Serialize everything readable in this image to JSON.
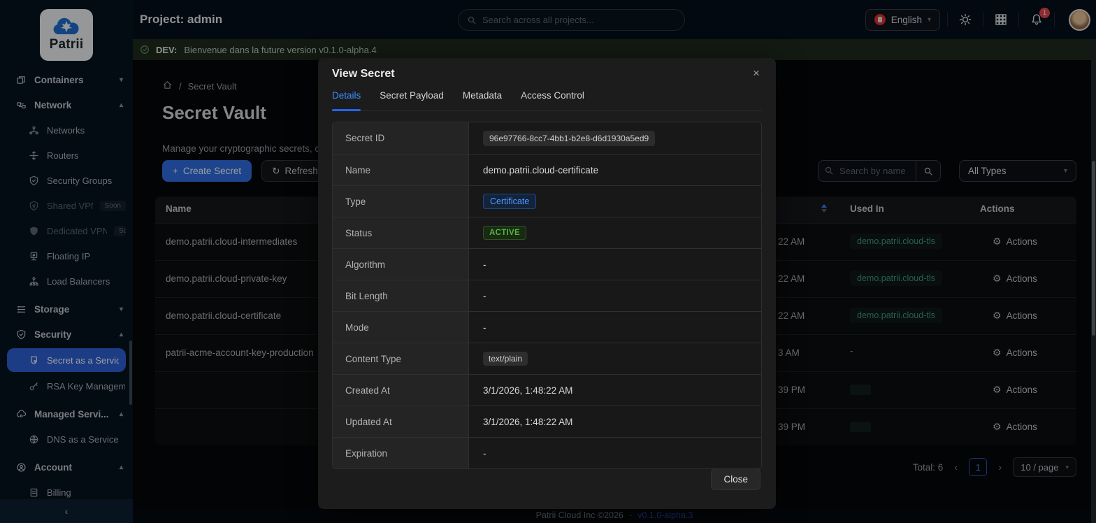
{
  "colors": {
    "accent": "#2f6fe4",
    "status_green": "#58b33c",
    "link_teal": "#3f9b83",
    "banner_bg": "#1d2b1d",
    "sidebar_active_bg": "#2f62d8"
  },
  "topbar": {
    "project_label": "Project: admin",
    "search_placeholder": "Search across all projects...",
    "language": "English",
    "bell_badge": "1"
  },
  "sidebar": {
    "logo_text": "Patrii",
    "items": {
      "containers": "Containers",
      "network": "Network",
      "networks": "Networks",
      "routers": "Routers",
      "security_groups": "Security Groups",
      "shared_vpn": "Shared VPN",
      "shared_vpn_badge": "Soon",
      "dedicated_vpn": "Dedicated VPN",
      "dedicated_vpn_badge": "Soon",
      "floating_ip": "Floating IP",
      "load_balancers": "Load Balancers",
      "storage": "Storage",
      "security": "Security",
      "secret_service": "Secret as a Service",
      "rsa_key": "RSA Key Manageme",
      "managed_services": "Managed Servi...",
      "dns_service": "DNS as a Service",
      "account": "Account",
      "billing": "Billing"
    },
    "collapse": "‹"
  },
  "banner": {
    "tag": "DEV:",
    "message": "Bienvenue dans la future version v0.1.0-alpha.4"
  },
  "page": {
    "breadcrumb_sep": "/",
    "breadcrumb": "Secret Vault",
    "title": "Secret Vault",
    "description": "Manage your cryptographic secrets, cert",
    "create_button": "Create Secret",
    "refresh_button": "Refresh",
    "filter_search_placeholder": "Search by name or al...",
    "type_filter": "All Types"
  },
  "table": {
    "headers": {
      "name": "Name",
      "used_in": "Used In",
      "actions": "Actions"
    },
    "action_label": "Actions",
    "rows": [
      {
        "name": "demo.patrii.cloud-intermediates",
        "time": "22 AM",
        "used_in": "demo.patrii.cloud-tls"
      },
      {
        "name": "demo.patrii.cloud-private-key",
        "time": "22 AM",
        "used_in": "demo.patrii.cloud-tls"
      },
      {
        "name": "demo.patrii.cloud-certificate",
        "time": "22 AM",
        "used_in": "demo.patrii.cloud-tls"
      },
      {
        "name": "patrii-acme-account-key-production",
        "time": "3 AM",
        "used_in": "-"
      },
      {
        "name": "",
        "time": "39 PM",
        "used_in": ""
      },
      {
        "name": "",
        "time": "39 PM",
        "used_in": ""
      }
    ]
  },
  "pagination": {
    "total": "Total: 6",
    "prev": "‹",
    "page": "1",
    "next": "›",
    "page_size": "10 / page"
  },
  "footer": {
    "company": "Patrii Cloud Inc ©2026",
    "separator": "·",
    "version": "v0.1.0-alpha.3"
  },
  "modal": {
    "title": "View Secret",
    "close_icon": "×",
    "tabs": [
      "Details",
      "Secret Payload",
      "Metadata",
      "Access Control"
    ],
    "rows": [
      {
        "label": "Secret ID",
        "value": "96e97766-8cc7-4bb1-b2e8-d6d1930a5ed9"
      },
      {
        "label": "Name",
        "value": "demo.patrii.cloud-certificate"
      },
      {
        "label": "Type",
        "value": "Certificate"
      },
      {
        "label": "Status",
        "value": "ACTIVE"
      },
      {
        "label": "Algorithm",
        "value": "-"
      },
      {
        "label": "Bit Length",
        "value": "-"
      },
      {
        "label": "Mode",
        "value": "-"
      },
      {
        "label": "Content Type",
        "value": "text/plain"
      },
      {
        "label": "Created At",
        "value": "3/1/2026, 1:48:22 AM"
      },
      {
        "label": "Updated At",
        "value": "3/1/2026, 1:48:22 AM"
      },
      {
        "label": "Expiration",
        "value": "-"
      }
    ],
    "close_button": "Close"
  }
}
